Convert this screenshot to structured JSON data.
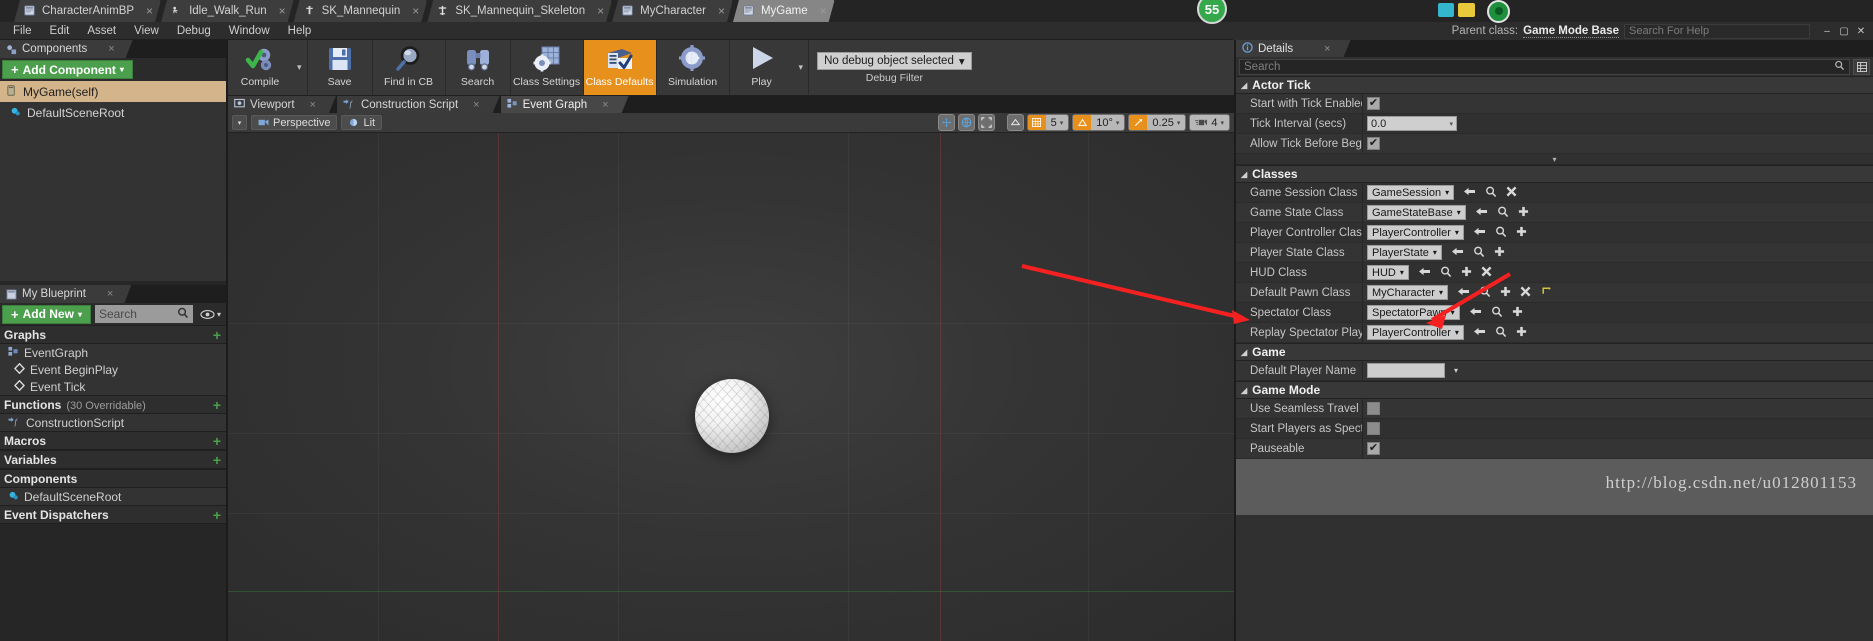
{
  "window": {
    "badge_count": "55",
    "minimize": "–",
    "maximize": "▢",
    "close": "✕"
  },
  "tabs": [
    {
      "label": "CharacterAnimBP",
      "icon": "blueprint-icon",
      "close": "×",
      "active": false
    },
    {
      "label": "Idle_Walk_Run",
      "icon": "animation-icon",
      "close": "×",
      "active": false
    },
    {
      "label": "SK_Mannequin",
      "icon": "skeletalmesh-icon",
      "close": "×",
      "active": false
    },
    {
      "label": "SK_Mannequin_Skeleton",
      "icon": "skeleton-icon",
      "close": "×",
      "active": false
    },
    {
      "label": "MyCharacter",
      "icon": "blueprint-icon",
      "close": "×",
      "active": false
    },
    {
      "label": "MyGame",
      "icon": "blueprint-icon",
      "close": "×",
      "active": true
    }
  ],
  "menubar": [
    "File",
    "Edit",
    "Asset",
    "View",
    "Debug",
    "Window",
    "Help"
  ],
  "parent_class": {
    "label": "Parent class:",
    "value": "Game Mode Base",
    "search_placeholder": "Search For Help"
  },
  "toolbar": {
    "buttons": [
      {
        "label": "Compile",
        "icon": "compile-icon",
        "has_caret": true,
        "active": false
      },
      {
        "label": "Save",
        "icon": "save-icon",
        "has_caret": false,
        "active": false
      },
      {
        "label": "Find in CB",
        "icon": "find-in-content-browser-icon",
        "has_caret": false,
        "active": false
      },
      {
        "label": "Search",
        "icon": "search-binoculars-icon",
        "has_caret": false,
        "active": false
      },
      {
        "label": "Class Settings",
        "icon": "class-settings-icon",
        "has_caret": false,
        "active": false
      },
      {
        "label": "Class Defaults",
        "icon": "class-defaults-icon",
        "has_caret": false,
        "active": true
      },
      {
        "label": "Simulation",
        "icon": "simulation-icon",
        "has_caret": false,
        "active": false
      },
      {
        "label": "Play",
        "icon": "play-icon",
        "has_caret": true,
        "active": false
      }
    ],
    "debug_filter": {
      "value": "No debug object selected",
      "caret": "▾",
      "label": "Debug Filter"
    }
  },
  "components_panel": {
    "tab_label": "Components",
    "tab_close": "×",
    "add_button": {
      "plus": "+",
      "label": "Add Component",
      "caret": "▾"
    },
    "items": [
      {
        "label": "MyGame(self)",
        "icon": "blueprint-self-icon",
        "selected": true
      },
      {
        "label": "DefaultSceneRoot",
        "icon": "scene-root-icon",
        "selected": false
      }
    ]
  },
  "myblueprint_panel": {
    "tab_label": "My Blueprint",
    "tab_close": "×",
    "add_new": {
      "plus": "+",
      "label": "Add New",
      "caret": "▾"
    },
    "search_placeholder": "Search",
    "search_icon": "search-icon",
    "eye_icon": "eye-icon",
    "eye_caret": "▾",
    "sections": [
      {
        "title": "Graphs",
        "sub": "",
        "add": "+",
        "rows": [
          {
            "label": "EventGraph",
            "icon": "graph-icon",
            "indent": 0
          },
          {
            "label": "Event BeginPlay",
            "icon": "event-node-icon",
            "indent": 1
          },
          {
            "label": "Event Tick",
            "icon": "event-node-icon",
            "indent": 1
          }
        ]
      },
      {
        "title": "Functions",
        "sub": "(30 Overridable)",
        "add": "+",
        "rows": [
          {
            "label": "ConstructionScript",
            "icon": "function-icon",
            "indent": 0
          }
        ]
      },
      {
        "title": "Macros",
        "sub": "",
        "add": "+",
        "rows": []
      },
      {
        "title": "Variables",
        "sub": "",
        "add": "+",
        "rows": []
      },
      {
        "title": "Components",
        "sub": "",
        "add": "",
        "rows": [
          {
            "label": "DefaultSceneRoot",
            "icon": "scene-root-icon",
            "indent": 0
          }
        ]
      },
      {
        "title": "Event Dispatchers",
        "sub": "",
        "add": "+",
        "rows": []
      }
    ]
  },
  "viewport": {
    "tabs": [
      {
        "label": "Viewport",
        "icon": "viewport-icon",
        "close": "×",
        "active": false
      },
      {
        "label": "Construction Script",
        "icon": "construction-script-icon",
        "close": "×",
        "active": false
      },
      {
        "label": "Event Graph",
        "icon": "event-graph-icon",
        "close": "×",
        "active": true
      }
    ],
    "view_menu_caret": "▾",
    "perspective": {
      "label": "Perspective",
      "icon": "camera-icon",
      "caret": "▾"
    },
    "lit": {
      "label": "Lit",
      "icon": "lit-icon",
      "caret": "▾"
    },
    "right_controls": [
      {
        "name": "transform-tools",
        "icon": "move-rotate-scale-icon"
      },
      {
        "name": "coordinate-system",
        "icon": "world-axis-icon"
      },
      {
        "name": "camera-speed-full",
        "icon": "fullscreen-icon"
      },
      {
        "name": "snap-toggle",
        "icon": "snap-icon"
      }
    ],
    "grid_snap": {
      "icon": "grid-snap-icon",
      "value": "5",
      "caret": "▾"
    },
    "rot_snap": {
      "icon": "rotation-snap-icon",
      "value": "10°",
      "caret": "▾"
    },
    "scale_snap": {
      "icon": "scale-snap-icon",
      "value": "0.25",
      "caret": "▾"
    },
    "cam_speed": {
      "icon": "camera-speed-icon",
      "value": "4",
      "caret": "▾"
    }
  },
  "details_panel": {
    "tab_label": "Details",
    "tab_icon": "details-info-icon",
    "tab_close": "×",
    "search_placeholder": "Search",
    "search_icon": "search-icon",
    "settings_icon": "view-options-icon",
    "expander": "▾",
    "categories": [
      {
        "title": "Actor Tick",
        "tri": "◢",
        "rows": [
          {
            "label": "Start with Tick Enabled",
            "type": "checkbox",
            "checked": true
          },
          {
            "label": "Tick Interval (secs)",
            "type": "number",
            "value": "0.0"
          },
          {
            "label": "Allow Tick Before Begin",
            "type": "checkbox",
            "checked": true
          }
        ]
      },
      {
        "title": "Classes",
        "tri": "◢",
        "rows": [
          {
            "label": "Game Session Class",
            "type": "class",
            "value": "GameSession",
            "actions": [
              "back-arrow-icon",
              "browse-icon",
              "clear-x-icon"
            ]
          },
          {
            "label": "Game State Class",
            "type": "class",
            "value": "GameStateBase",
            "actions": [
              "back-arrow-icon",
              "browse-icon",
              "new-plus-icon"
            ]
          },
          {
            "label": "Player Controller Class",
            "type": "class",
            "value": "PlayerController",
            "actions": [
              "back-arrow-icon",
              "browse-icon",
              "new-plus-icon"
            ]
          },
          {
            "label": "Player State Class",
            "type": "class",
            "value": "PlayerState",
            "actions": [
              "back-arrow-icon",
              "browse-icon",
              "new-plus-icon"
            ]
          },
          {
            "label": "HUD Class",
            "type": "class",
            "value": "HUD",
            "actions": [
              "back-arrow-icon",
              "browse-icon",
              "new-plus-icon",
              "clear-x-icon"
            ]
          },
          {
            "label": "Default Pawn Class",
            "type": "class",
            "value": "MyCharacter",
            "highlighted": true,
            "actions": [
              "back-arrow-icon",
              "browse-icon",
              "new-plus-icon",
              "clear-x-icon",
              "reset-arrow-icon"
            ]
          },
          {
            "label": "Spectator Class",
            "type": "class",
            "value": "SpectatorPawn",
            "actions": [
              "back-arrow-icon",
              "browse-icon",
              "new-plus-icon"
            ]
          },
          {
            "label": "Replay Spectator Player",
            "type": "class",
            "value": "PlayerController",
            "actions": [
              "back-arrow-icon",
              "browse-icon",
              "new-plus-icon"
            ]
          }
        ]
      },
      {
        "title": "Game",
        "tri": "◢",
        "rows": [
          {
            "label": "Default Player Name",
            "type": "text",
            "value": "",
            "caret": "▾"
          }
        ]
      },
      {
        "title": "Game Mode",
        "tri": "◢",
        "rows": [
          {
            "label": "Use Seamless Travel",
            "type": "checkbox",
            "checked": false
          },
          {
            "label": "Start Players as Spectat",
            "type": "checkbox",
            "checked": false
          },
          {
            "label": "Pauseable",
            "type": "checkbox",
            "checked": true
          }
        ]
      }
    ],
    "watermark": "http://blog.csdn.net/u012801153"
  }
}
